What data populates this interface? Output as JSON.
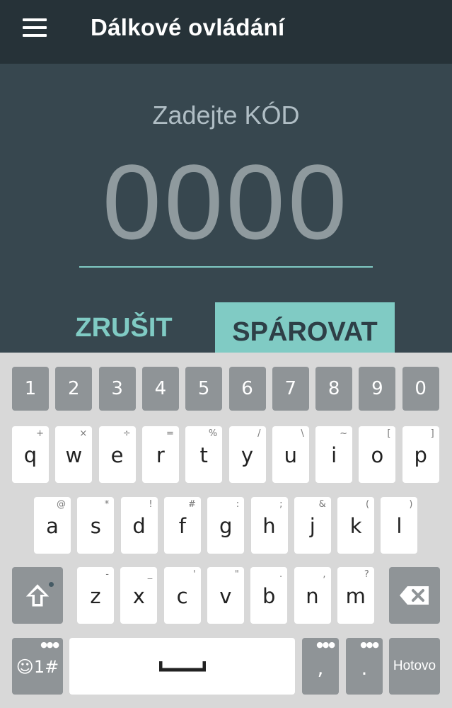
{
  "appbar": {
    "title": "Dálkové ovládání",
    "menu_icon": "hamburger-menu-icon"
  },
  "pairing": {
    "prompt": "Zadejte KÓD",
    "code_value": "0000",
    "cancel_label": "ZRUŠIT",
    "pair_label": "SPÁROVAT"
  },
  "keyboard": {
    "number_row": [
      "1",
      "2",
      "3",
      "4",
      "5",
      "6",
      "7",
      "8",
      "9",
      "0"
    ],
    "row1": [
      {
        "main": "q",
        "sub": "+"
      },
      {
        "main": "w",
        "sub": "×"
      },
      {
        "main": "e",
        "sub": "÷"
      },
      {
        "main": "r",
        "sub": "="
      },
      {
        "main": "t",
        "sub": "%"
      },
      {
        "main": "y",
        "sub": "/"
      },
      {
        "main": "u",
        "sub": "\\"
      },
      {
        "main": "i",
        "sub": "~"
      },
      {
        "main": "o",
        "sub": "["
      },
      {
        "main": "p",
        "sub": "]"
      }
    ],
    "row2": [
      {
        "main": "a",
        "sub": "@"
      },
      {
        "main": "s",
        "sub": "*"
      },
      {
        "main": "d",
        "sub": "!"
      },
      {
        "main": "f",
        "sub": "#"
      },
      {
        "main": "g",
        "sub": ":"
      },
      {
        "main": "h",
        "sub": ";"
      },
      {
        "main": "j",
        "sub": "&"
      },
      {
        "main": "k",
        "sub": "("
      },
      {
        "main": "l",
        "sub": ")"
      }
    ],
    "row3": [
      {
        "main": "z",
        "sub": "-"
      },
      {
        "main": "x",
        "sub": "_"
      },
      {
        "main": "c",
        "sub": "'"
      },
      {
        "main": "v",
        "sub": "\""
      },
      {
        "main": "b",
        "sub": "."
      },
      {
        "main": "n",
        "sub": ","
      },
      {
        "main": "m",
        "sub": "?"
      }
    ],
    "symbols_label": "☺1#",
    "comma_label": ",",
    "period_label": ".",
    "done_label": "Hotovo",
    "shift_icon": "shift-arrow-icon",
    "backspace_icon": "backspace-icon",
    "space_icon": "space-bar-icon"
  },
  "colors": {
    "accent": "#80cbc4",
    "appbar": "#263238",
    "background": "#37474f"
  }
}
